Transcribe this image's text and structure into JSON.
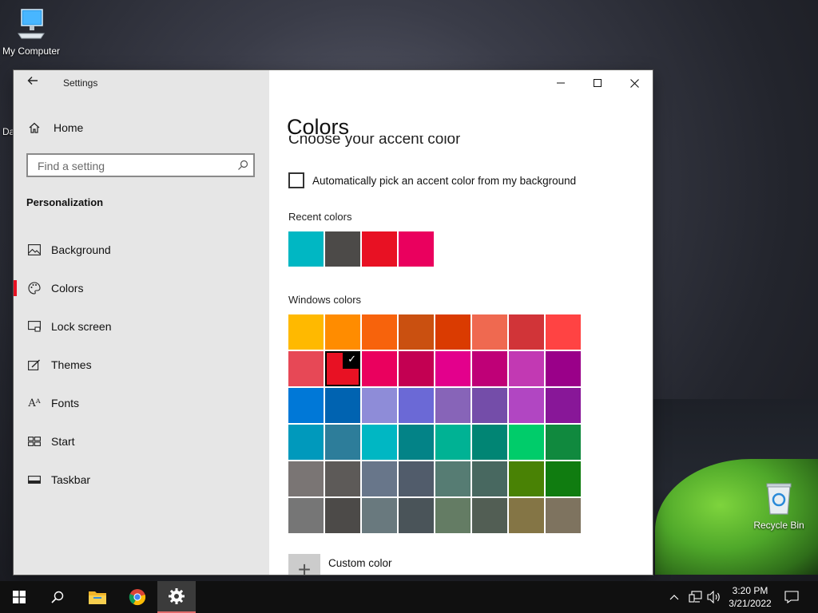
{
  "desktop": {
    "icons": [
      {
        "label": "My Computer",
        "icon": "computer-icon"
      },
      {
        "label": "Recycle Bin",
        "icon": "recycle-bin-icon"
      }
    ],
    "partial_label": "Da"
  },
  "window": {
    "title": "Settings",
    "controls": [
      "minimize",
      "maximize",
      "close"
    ]
  },
  "sidebar": {
    "home_label": "Home",
    "search_placeholder": "Find a setting",
    "section_title": "Personalization",
    "items": [
      {
        "label": "Background",
        "icon": "picture-icon",
        "selected": false
      },
      {
        "label": "Colors",
        "icon": "palette-icon",
        "selected": true
      },
      {
        "label": "Lock screen",
        "icon": "lock-screen-icon",
        "selected": false
      },
      {
        "label": "Themes",
        "icon": "themes-icon",
        "selected": false
      },
      {
        "label": "Fonts",
        "icon": "fonts-icon",
        "selected": false
      },
      {
        "label": "Start",
        "icon": "start-icon",
        "selected": false
      },
      {
        "label": "Taskbar",
        "icon": "taskbar-icon",
        "selected": false
      }
    ]
  },
  "content": {
    "title": "Colors",
    "clipped_heading": "Choose your accent color",
    "auto_pick_label": "Automatically pick an accent color from my background",
    "auto_pick_checked": false,
    "recent_label": "Recent colors",
    "recent_colors": [
      "#00b7c3",
      "#4c4a48",
      "#e81123",
      "#ea005e"
    ],
    "windows_label": "Windows colors",
    "windows_colors": [
      [
        "#ffb900",
        "#ff8c00",
        "#f7630c",
        "#ca5010",
        "#da3b01",
        "#ef6950",
        "#d13438",
        "#ff4343"
      ],
      [
        "#e74856",
        "#e81123",
        "#ea005e",
        "#c30052",
        "#e3008c",
        "#bf0077",
        "#c239b3",
        "#9a0089"
      ],
      [
        "#0078d7",
        "#0063b1",
        "#8e8cd8",
        "#6b69d6",
        "#8764b8",
        "#744da9",
        "#b146c2",
        "#881798"
      ],
      [
        "#0099bc",
        "#2d7d9a",
        "#00b7c3",
        "#038387",
        "#00b294",
        "#018574",
        "#00cc6a",
        "#10893e"
      ],
      [
        "#7a7574",
        "#5d5a58",
        "#68768a",
        "#515c6b",
        "#567c73",
        "#486860",
        "#498205",
        "#107c10"
      ],
      [
        "#767676",
        "#4c4a48",
        "#69797e",
        "#4a5459",
        "#647c64",
        "#525e54",
        "#847545",
        "#7e735f"
      ]
    ],
    "selected_color": {
      "row": 1,
      "col": 1
    },
    "custom_color_label": "Custom color"
  },
  "taskbar": {
    "buttons": [
      {
        "name": "start-button",
        "icon": "windows-logo-icon"
      },
      {
        "name": "search-button",
        "icon": "search-icon"
      },
      {
        "name": "file-explorer-button",
        "icon": "folder-icon"
      },
      {
        "name": "chrome-button",
        "icon": "chrome-icon"
      },
      {
        "name": "settings-button",
        "icon": "gear-icon",
        "active": true
      }
    ],
    "clock_time": "3:20 PM",
    "clock_date": "3/21/2022"
  }
}
